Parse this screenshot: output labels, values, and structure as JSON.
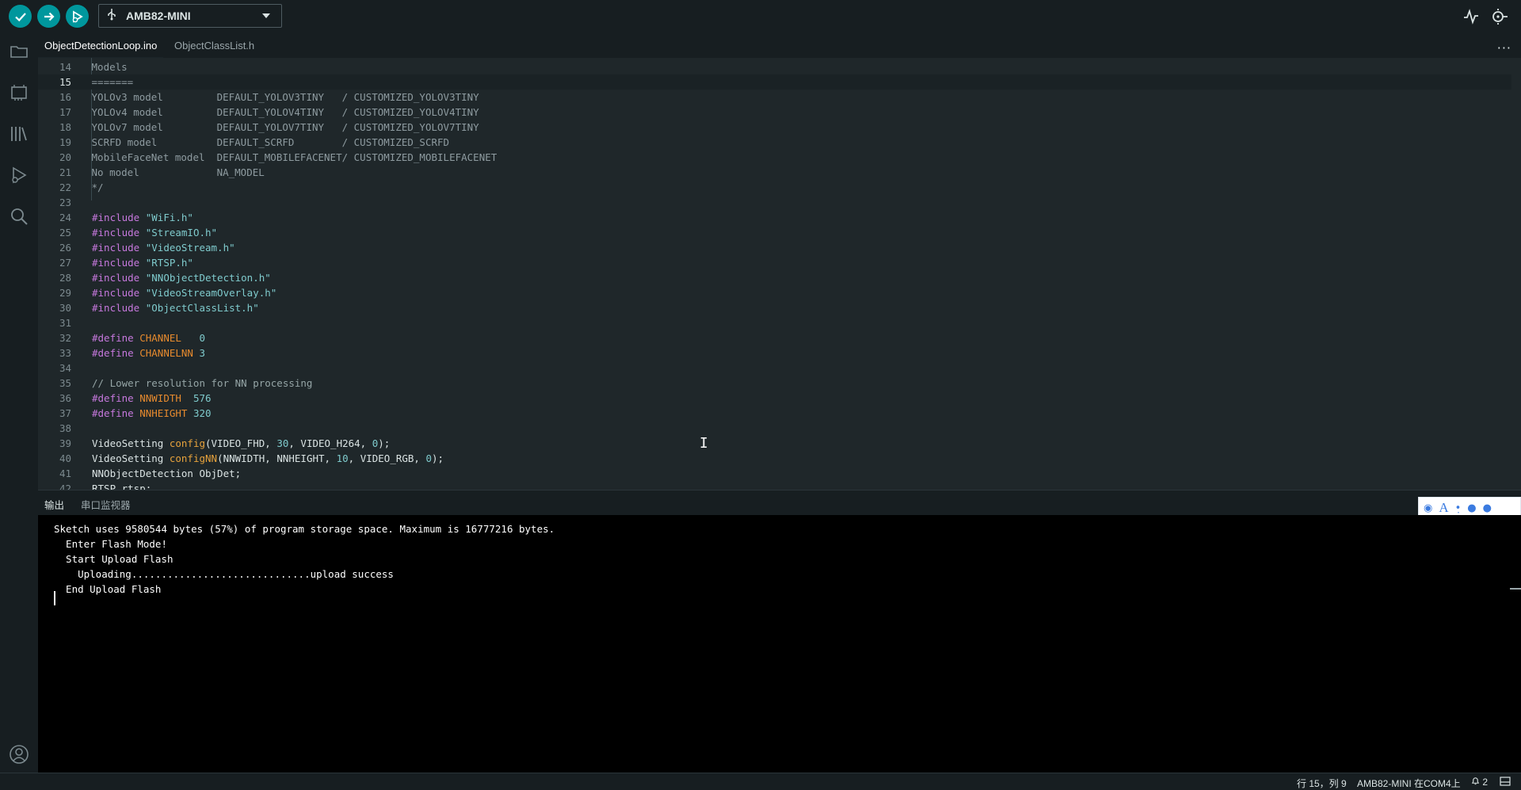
{
  "toolbar": {
    "verify_icon": "check-icon",
    "upload_icon": "arrow-right-icon",
    "debug_icon": "debug-icon",
    "board_name": "AMB82-MINI",
    "usb_icon": "usb-icon",
    "serial_plotter_icon": "plotter-icon",
    "serial_monitor_icon": "monitor-icon"
  },
  "tabs": [
    {
      "label": "ObjectDetectionLoop.ino",
      "active": true
    },
    {
      "label": "ObjectClassList.h",
      "active": false
    }
  ],
  "tabs_more": "···",
  "editor": {
    "current_line": 15,
    "lines": [
      {
        "n": "14",
        "code": " Models"
      },
      {
        "n": "15",
        "code": " ======="
      },
      {
        "n": "16",
        "code": " YOLOv3 model         DEFAULT_YOLOV3TINY   / CUSTOMIZED_YOLOV3TINY"
      },
      {
        "n": "17",
        "code": " YOLOv4 model         DEFAULT_YOLOV4TINY   / CUSTOMIZED_YOLOV4TINY"
      },
      {
        "n": "18",
        "code": " YOLOv7 model         DEFAULT_YOLOV7TINY   / CUSTOMIZED_YOLOV7TINY"
      },
      {
        "n": "19",
        "code": " SCRFD model          DEFAULT_SCRFD        / CUSTOMIZED_SCRFD"
      },
      {
        "n": "20",
        "code": " MobileFaceNet model  DEFAULT_MOBILEFACENET/ CUSTOMIZED_MOBILEFACENET"
      },
      {
        "n": "21",
        "code": " No model             NA_MODEL"
      },
      {
        "n": "22",
        "code": " */"
      },
      {
        "n": "23",
        "code": ""
      },
      {
        "n": "24",
        "pre": "#include",
        "str": " \"WiFi.h\""
      },
      {
        "n": "25",
        "pre": "#include",
        "str": " \"StreamIO.h\""
      },
      {
        "n": "26",
        "pre": "#include",
        "str": " \"VideoStream.h\""
      },
      {
        "n": "27",
        "pre": "#include",
        "str": " \"RTSP.h\""
      },
      {
        "n": "28",
        "pre": "#include",
        "str": " \"NNObjectDetection.h\""
      },
      {
        "n": "29",
        "pre": "#include",
        "str": " \"VideoStreamOverlay.h\""
      },
      {
        "n": "30",
        "pre": "#include",
        "str": " \"ObjectClassList.h\""
      },
      {
        "n": "31",
        "code": ""
      },
      {
        "n": "32",
        "pre": "#define",
        "mac": " CHANNEL",
        "num": "   0"
      },
      {
        "n": "33",
        "pre": "#define",
        "mac": " CHANNELNN",
        "num": " 3"
      },
      {
        "n": "34",
        "code": ""
      },
      {
        "n": "35",
        "comment": "// Lower resolution for NN processing"
      },
      {
        "n": "36",
        "pre": "#define",
        "mac": " NNWIDTH",
        "num": "  576"
      },
      {
        "n": "37",
        "pre": "#define",
        "mac": " NNHEIGHT",
        "num": " 320"
      },
      {
        "n": "38",
        "code": ""
      },
      {
        "n": "39",
        "type": "VideoSetting ",
        "fn": "config",
        "args": "(VIDEO_FHD, ",
        "a1": "30",
        "args2": ", VIDEO_H264, ",
        "a2": "0",
        "args3": ");"
      },
      {
        "n": "40",
        "type": "VideoSetting ",
        "fn": "configNN",
        "args": "(NNWIDTH, NNHEIGHT, ",
        "a1": "10",
        "args2": ", VIDEO_RGB, ",
        "a2": "0",
        "args3": ");"
      },
      {
        "n": "41",
        "plain": "NNObjectDetection ObjDet;"
      },
      {
        "n": "42",
        "plain": "RTSP rtsp;"
      }
    ]
  },
  "panel": {
    "tab_output": "输出",
    "tab_serial": "串口监视器",
    "ime_icon": "ime-toolbar-icon",
    "output_lines": [
      "Sketch uses 9580544 bytes (57%) of program storage space. Maximum is 16777216 bytes.",
      "  Enter Flash Mode!",
      "  Start Upload Flash",
      "    Uploading..............................upload success",
      "  End Upload Flash"
    ]
  },
  "sidebar": {
    "items": [
      "folder-icon",
      "board-icon",
      "library-icon",
      "debug-icon",
      "search-icon"
    ],
    "account_icon": "account-icon"
  },
  "status": {
    "position": "行 15，列 9",
    "board_port": "AMB82-MINI 在COM4上",
    "notifications": "2"
  }
}
